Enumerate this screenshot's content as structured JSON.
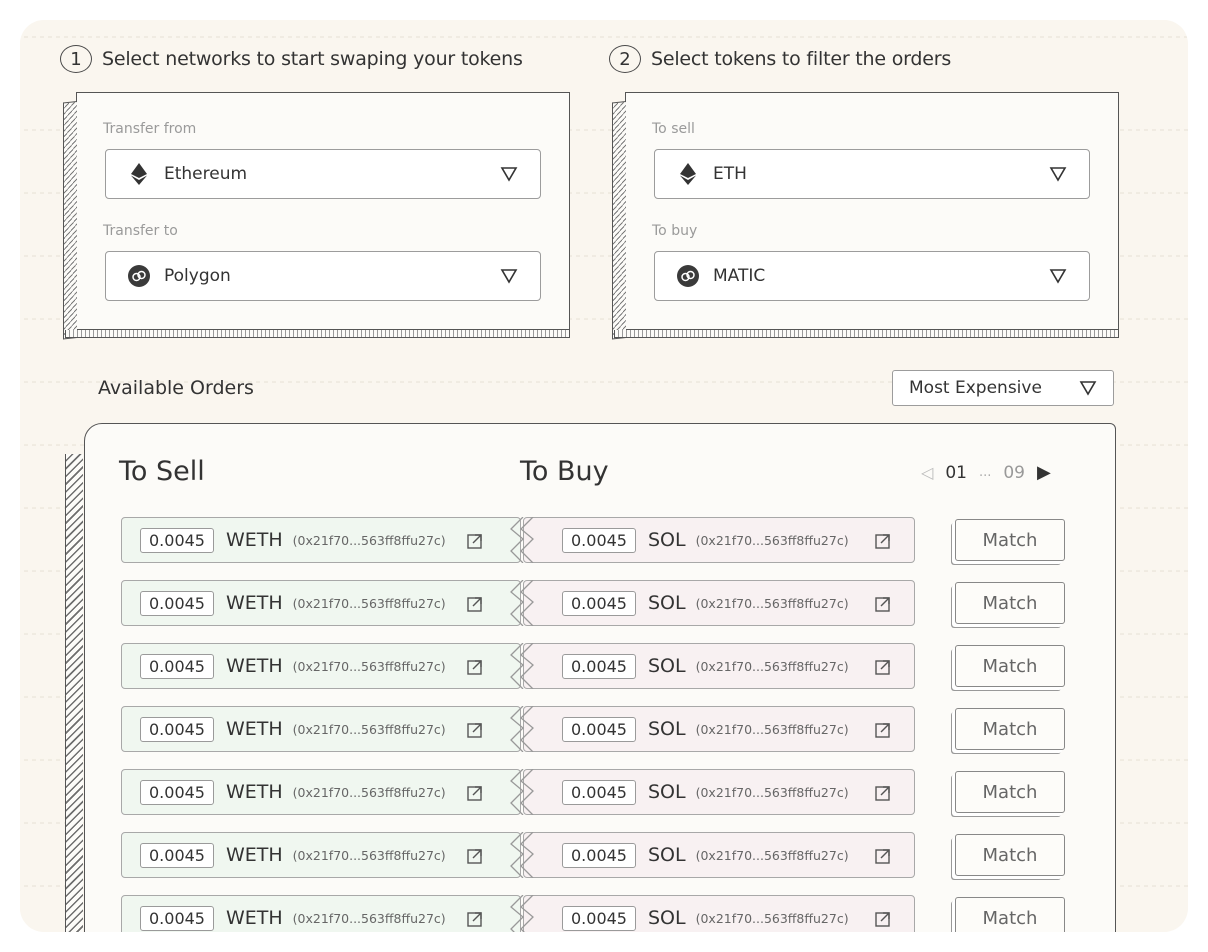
{
  "steps": [
    {
      "num": "1",
      "title": "Select networks to start swaping your tokens"
    },
    {
      "num": "2",
      "title": "Select tokens to filter the orders"
    }
  ],
  "networks": {
    "from_label": "Transfer from",
    "from_value": "Ethereum",
    "from_icon": "ethereum-icon",
    "to_label": "Transfer to",
    "to_value": "Polygon",
    "to_icon": "polygon-icon"
  },
  "tokens": {
    "sell_label": "To sell",
    "sell_value": "ETH",
    "sell_icon": "ethereum-icon",
    "buy_label": "To buy",
    "buy_value": "MATIC",
    "buy_icon": "polygon-icon"
  },
  "orders_section": {
    "title": "Available Orders",
    "sort_value": "Most Expensive",
    "col_sell": "To Sell",
    "col_buy": "To Buy",
    "pager": {
      "current": "01",
      "dots": "...",
      "last": "09"
    },
    "match_label": "Match",
    "rows": [
      {
        "sell_amount": "0.0045",
        "sell_token": "WETH",
        "sell_addr": "(0x21f70...563ff8ffu27c)",
        "buy_amount": "0.0045",
        "buy_token": "SOL",
        "buy_addr": "(0x21f70...563ff8ffu27c)"
      },
      {
        "sell_amount": "0.0045",
        "sell_token": "WETH",
        "sell_addr": "(0x21f70...563ff8ffu27c)",
        "buy_amount": "0.0045",
        "buy_token": "SOL",
        "buy_addr": "(0x21f70...563ff8ffu27c)"
      },
      {
        "sell_amount": "0.0045",
        "sell_token": "WETH",
        "sell_addr": "(0x21f70...563ff8ffu27c)",
        "buy_amount": "0.0045",
        "buy_token": "SOL",
        "buy_addr": "(0x21f70...563ff8ffu27c)"
      },
      {
        "sell_amount": "0.0045",
        "sell_token": "WETH",
        "sell_addr": "(0x21f70...563ff8ffu27c)",
        "buy_amount": "0.0045",
        "buy_token": "SOL",
        "buy_addr": "(0x21f70...563ff8ffu27c)"
      },
      {
        "sell_amount": "0.0045",
        "sell_token": "WETH",
        "sell_addr": "(0x21f70...563ff8ffu27c)",
        "buy_amount": "0.0045",
        "buy_token": "SOL",
        "buy_addr": "(0x21f70...563ff8ffu27c)"
      },
      {
        "sell_amount": "0.0045",
        "sell_token": "WETH",
        "sell_addr": "(0x21f70...563ff8ffu27c)",
        "buy_amount": "0.0045",
        "buy_token": "SOL",
        "buy_addr": "(0x21f70...563ff8ffu27c)"
      },
      {
        "sell_amount": "0.0045",
        "sell_token": "WETH",
        "sell_addr": "(0x21f70...563ff8ffu27c)",
        "buy_amount": "0.0045",
        "buy_token": "SOL",
        "buy_addr": "(0x21f70...563ff8ffu27c)"
      }
    ]
  },
  "colors": {
    "sell_bg": "#f0f7f0",
    "buy_bg": "#f8f1f2",
    "page_bg": "#faf6ef"
  }
}
